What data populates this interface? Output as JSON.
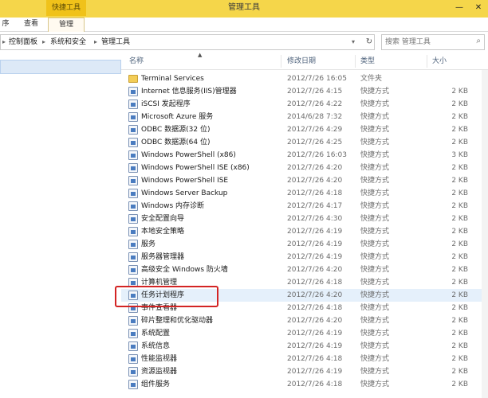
{
  "window": {
    "title": "管理工具",
    "context_tab": "快捷工具",
    "minimize": "—",
    "close": "✕"
  },
  "ribbon": {
    "tabs": [
      {
        "label": "序"
      },
      {
        "label": "查看"
      },
      {
        "label": "管理"
      }
    ]
  },
  "address": {
    "crumbs": [
      "控制面板",
      "系统和安全",
      "管理工具"
    ],
    "search_placeholder": "搜索 管理工具"
  },
  "columns": {
    "name": "名称",
    "date": "修改日期",
    "type": "类型",
    "size": "大小"
  },
  "files": [
    {
      "name": "Terminal Services",
      "date": "2012/7/26 16:05",
      "type": "文件夹",
      "size": "",
      "icon": "folder-icon"
    },
    {
      "name": "Internet 信息服务(IIS)管理器",
      "date": "2012/7/26 4:15",
      "type": "快捷方式",
      "size": "2 KB",
      "icon": "shortcut-icon"
    },
    {
      "name": "iSCSI 发起程序",
      "date": "2012/7/26 4:22",
      "type": "快捷方式",
      "size": "2 KB",
      "icon": "shortcut-icon"
    },
    {
      "name": "Microsoft Azure 服务",
      "date": "2014/6/28 7:32",
      "type": "快捷方式",
      "size": "2 KB",
      "icon": "shortcut-icon"
    },
    {
      "name": "ODBC 数据源(32 位)",
      "date": "2012/7/26 4:29",
      "type": "快捷方式",
      "size": "2 KB",
      "icon": "shortcut-icon"
    },
    {
      "name": "ODBC 数据源(64 位)",
      "date": "2012/7/26 4:25",
      "type": "快捷方式",
      "size": "2 KB",
      "icon": "shortcut-icon"
    },
    {
      "name": "Windows PowerShell (x86)",
      "date": "2012/7/26 16:03",
      "type": "快捷方式",
      "size": "3 KB",
      "icon": "shortcut-icon"
    },
    {
      "name": "Windows PowerShell ISE (x86)",
      "date": "2012/7/26 4:20",
      "type": "快捷方式",
      "size": "2 KB",
      "icon": "shortcut-icon"
    },
    {
      "name": "Windows PowerShell ISE",
      "date": "2012/7/26 4:20",
      "type": "快捷方式",
      "size": "2 KB",
      "icon": "shortcut-icon"
    },
    {
      "name": "Windows Server Backup",
      "date": "2012/7/26 4:18",
      "type": "快捷方式",
      "size": "2 KB",
      "icon": "shortcut-icon"
    },
    {
      "name": "Windows 内存诊断",
      "date": "2012/7/26 4:17",
      "type": "快捷方式",
      "size": "2 KB",
      "icon": "shortcut-icon"
    },
    {
      "name": "安全配置向导",
      "date": "2012/7/26 4:30",
      "type": "快捷方式",
      "size": "2 KB",
      "icon": "shortcut-icon"
    },
    {
      "name": "本地安全策略",
      "date": "2012/7/26 4:19",
      "type": "快捷方式",
      "size": "2 KB",
      "icon": "shortcut-icon"
    },
    {
      "name": "服务",
      "date": "2012/7/26 4:19",
      "type": "快捷方式",
      "size": "2 KB",
      "icon": "shortcut-icon"
    },
    {
      "name": "服务器管理器",
      "date": "2012/7/26 4:19",
      "type": "快捷方式",
      "size": "2 KB",
      "icon": "shortcut-icon"
    },
    {
      "name": "高级安全 Windows 防火墙",
      "date": "2012/7/26 4:20",
      "type": "快捷方式",
      "size": "2 KB",
      "icon": "shortcut-icon"
    },
    {
      "name": "计算机管理",
      "date": "2012/7/26 4:18",
      "type": "快捷方式",
      "size": "2 KB",
      "icon": "shortcut-icon"
    },
    {
      "name": "任务计划程序",
      "date": "2012/7/26 4:20",
      "type": "快捷方式",
      "size": "2 KB",
      "icon": "shortcut-icon"
    },
    {
      "name": "事件查看器",
      "date": "2012/7/26 4:18",
      "type": "快捷方式",
      "size": "2 KB",
      "icon": "shortcut-icon"
    },
    {
      "name": "碎片整理和优化驱动器",
      "date": "2012/7/26 4:20",
      "type": "快捷方式",
      "size": "2 KB",
      "icon": "shortcut-icon"
    },
    {
      "name": "系统配置",
      "date": "2012/7/26 4:19",
      "type": "快捷方式",
      "size": "2 KB",
      "icon": "shortcut-icon"
    },
    {
      "name": "系统信息",
      "date": "2012/7/26 4:19",
      "type": "快捷方式",
      "size": "2 KB",
      "icon": "shortcut-icon"
    },
    {
      "name": "性能监视器",
      "date": "2012/7/26 4:18",
      "type": "快捷方式",
      "size": "2 KB",
      "icon": "shortcut-icon"
    },
    {
      "name": "资源监视器",
      "date": "2012/7/26 4:19",
      "type": "快捷方式",
      "size": "2 KB",
      "icon": "shortcut-icon"
    },
    {
      "name": "组件服务",
      "date": "2012/7/26 4:18",
      "type": "快捷方式",
      "size": "2 KB",
      "icon": "shortcut-icon"
    }
  ],
  "highlighted_item": "任务计划程序"
}
